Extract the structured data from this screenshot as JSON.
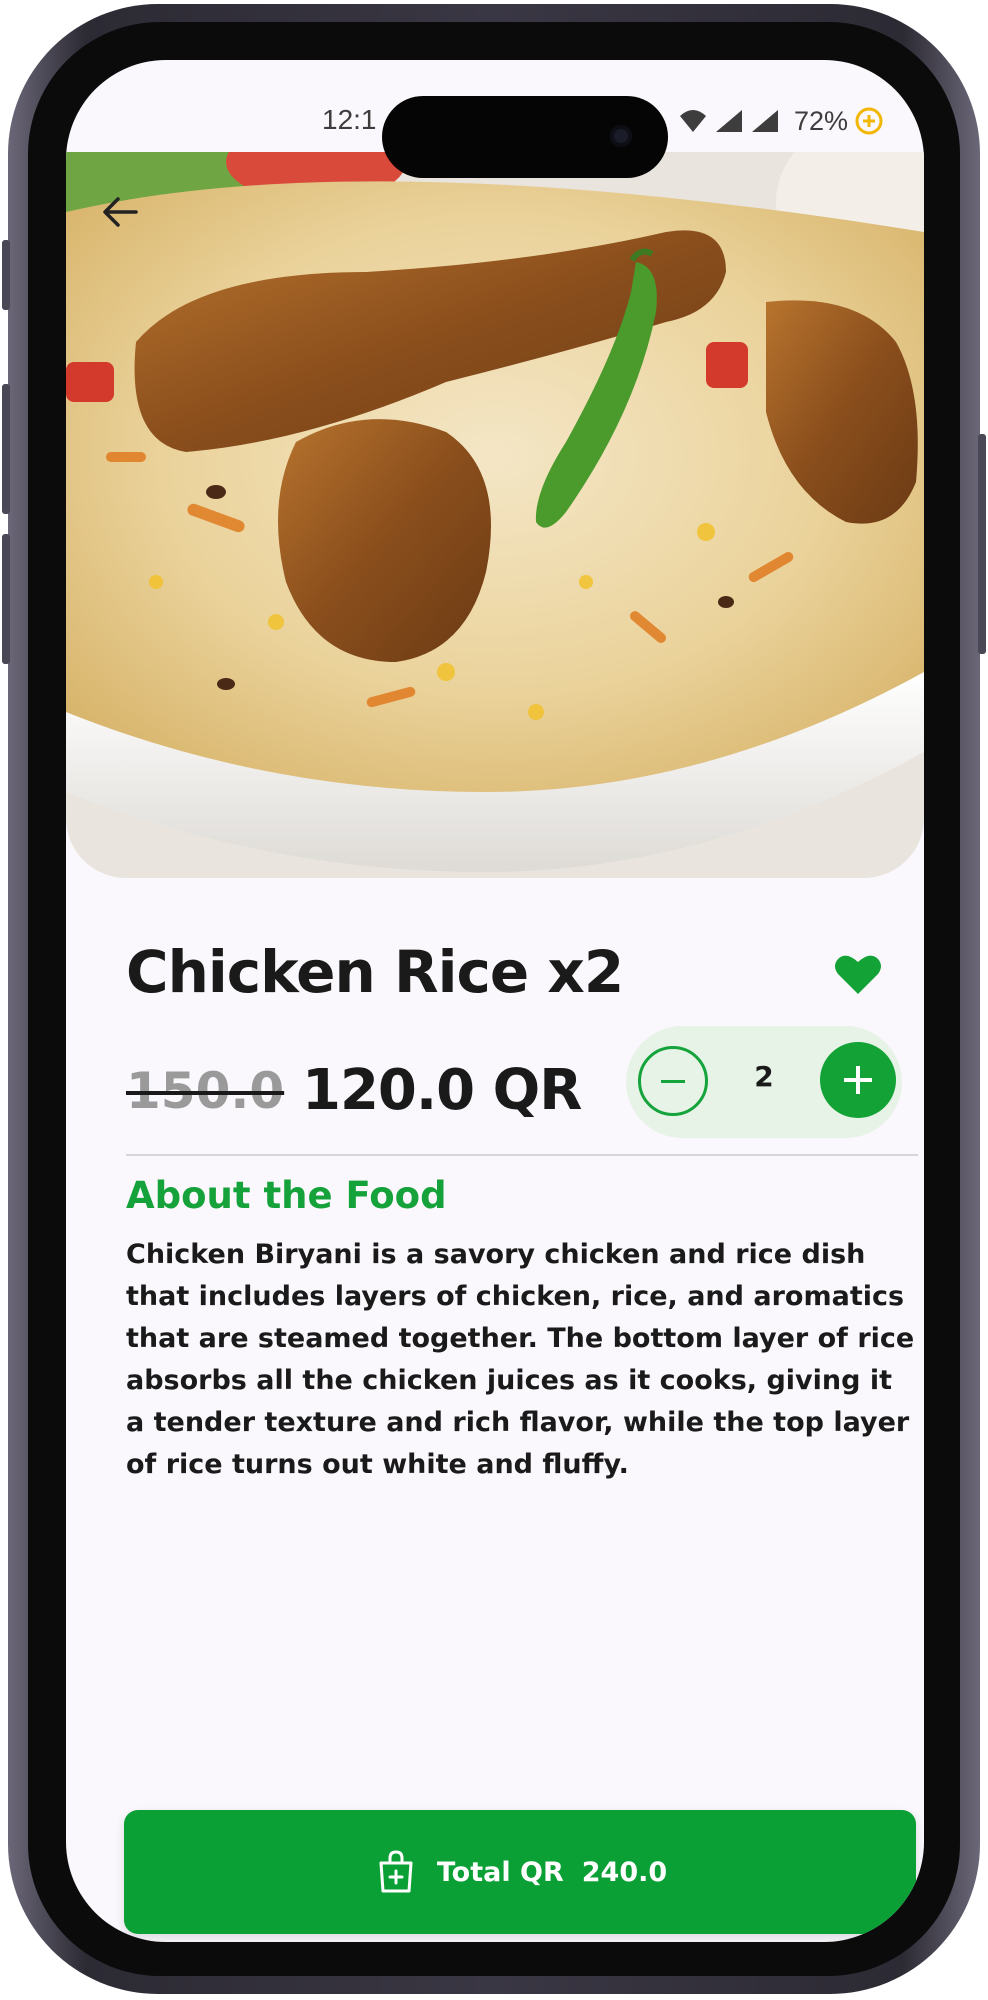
{
  "status_bar": {
    "time": "12:1",
    "battery": "72%"
  },
  "product": {
    "title": "Chicken Rice x2",
    "old_price": "150.0",
    "new_price": "120.0 QR",
    "quantity": "2"
  },
  "about": {
    "heading": "About the Food",
    "body": "Chicken Biryani is a savory chicken and rice dish that includes layers of chicken, rice, and aromatics that are steamed together. The bottom layer of rice absorbs all the chicken juices as it cooks, giving it a tender texture and rich flavor, while the top layer of rice turns out white and fluffy."
  },
  "cart_button": {
    "label": "Total QR",
    "amount": "240.0"
  },
  "colors": {
    "accent_green": "#12a235",
    "stepper_bg": "#e6f3e6",
    "text_dark": "#1a1a1a"
  },
  "icons": [
    "back-arrow-icon",
    "heart-icon",
    "minus-icon",
    "plus-icon",
    "shopping-bag-add-icon",
    "wifi-icon",
    "signal-icon",
    "battery-icon"
  ]
}
